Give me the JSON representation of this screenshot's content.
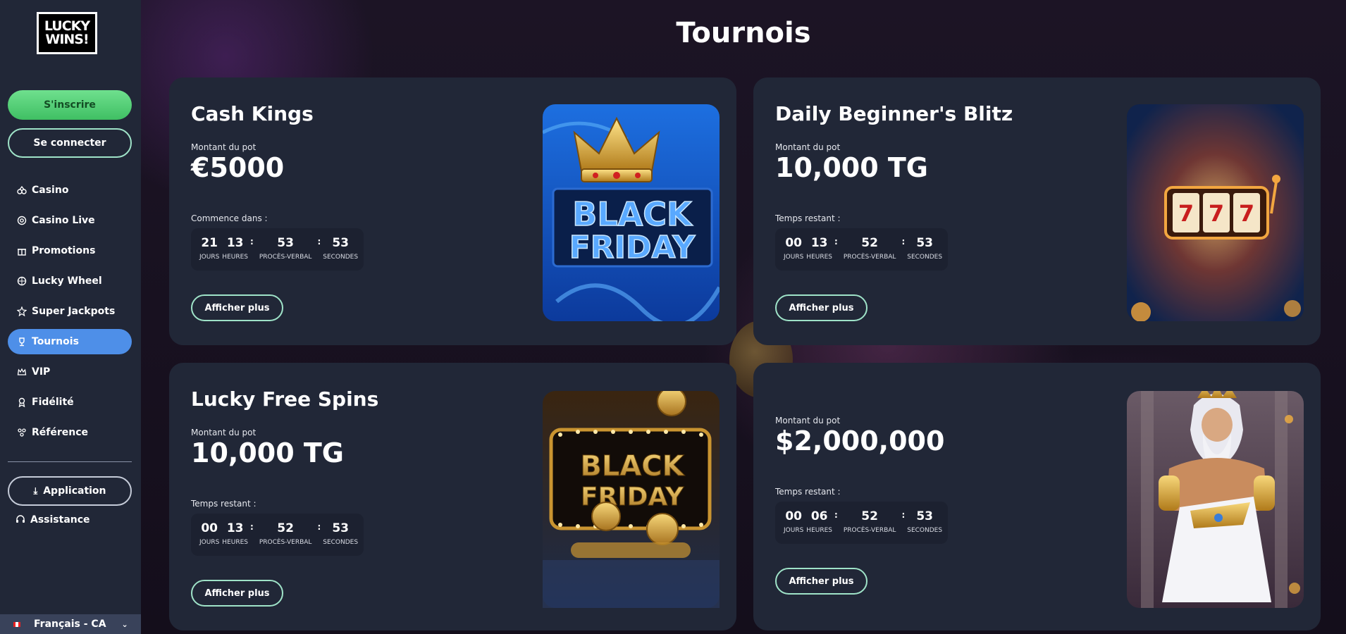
{
  "logo": {
    "line1": "LUCKY",
    "line2": "WINS!"
  },
  "auth": {
    "register": "S'inscrire",
    "login": "Se connecter"
  },
  "nav": [
    {
      "label": "Casino",
      "icon": "slot-icon"
    },
    {
      "label": "Casino Live",
      "icon": "chip-icon"
    },
    {
      "label": "Promotions",
      "icon": "gift-icon"
    },
    {
      "label": "Lucky Wheel",
      "icon": "wheel-icon"
    },
    {
      "label": "Super Jackpots",
      "icon": "jackpot-icon"
    },
    {
      "label": "Tournois",
      "icon": "trophy-icon",
      "active": true
    },
    {
      "label": "VIP",
      "icon": "crown-icon"
    },
    {
      "label": "Fidélité",
      "icon": "loyalty-icon"
    },
    {
      "label": "Référence",
      "icon": "referral-icon"
    }
  ],
  "app_button": "Application",
  "support": "Assistance",
  "language": "Français - CA",
  "page_title": "Tournois",
  "timer_labels": {
    "days": "JOURS",
    "hours": "HEURES",
    "minutes": "PROCÈS-VERBAL",
    "seconds": "SECONDES"
  },
  "more_label": "Afficher plus",
  "tournaments": [
    {
      "title": "Cash Kings",
      "pot_label": "Montant du pot",
      "pot": "€5000",
      "timer_label": "Commence dans :",
      "days": "21",
      "hours": "13",
      "minutes": "53",
      "seconds": "53",
      "art_text": [
        "BLACK",
        "FRIDAY"
      ]
    },
    {
      "title": "Daily Beginner's Blitz",
      "pot_label": "Montant du pot",
      "pot": "10,000 TG",
      "timer_label": "Temps restant :",
      "days": "00",
      "hours": "13",
      "minutes": "52",
      "seconds": "53"
    },
    {
      "title": "Lucky Free Spins",
      "pot_label": "Montant du pot",
      "pot": "10,000 TG",
      "timer_label": "Temps restant :",
      "days": "00",
      "hours": "13",
      "minutes": "52",
      "seconds": "53",
      "art_text": [
        "BLACK",
        "FRIDAY"
      ]
    },
    {
      "title": "",
      "pot_label": "Montant du pot",
      "pot": "$2,000,000",
      "timer_label": "Temps restant :",
      "days": "00",
      "hours": "06",
      "minutes": "52",
      "seconds": "53"
    }
  ]
}
